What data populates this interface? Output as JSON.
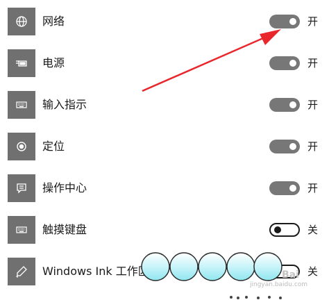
{
  "settings": [
    {
      "label": "网络",
      "state": "开",
      "on": true,
      "icon": "globe-icon"
    },
    {
      "label": "电源",
      "state": "开",
      "on": true,
      "icon": "battery-plug-icon"
    },
    {
      "label": "输入指示",
      "state": "开",
      "on": true,
      "icon": "keyboard-icon"
    },
    {
      "label": "定位",
      "state": "开",
      "on": true,
      "icon": "location-icon"
    },
    {
      "label": "操作中心",
      "state": "开",
      "on": true,
      "icon": "action-center-icon"
    },
    {
      "label": "触摸键盘",
      "state": "关",
      "on": false,
      "icon": "keyboard-icon"
    },
    {
      "label": "Windows Ink 工作区",
      "state": "关",
      "on": false,
      "icon": "pen-icon"
    }
  ],
  "watermark": {
    "line1": "Bai",
    "line2": "jingyan.baidu.com"
  },
  "colors": {
    "tile": "#707070",
    "toggle_on": "#777777",
    "arrow": "#e8262b",
    "bubble": "#bff2f8"
  }
}
